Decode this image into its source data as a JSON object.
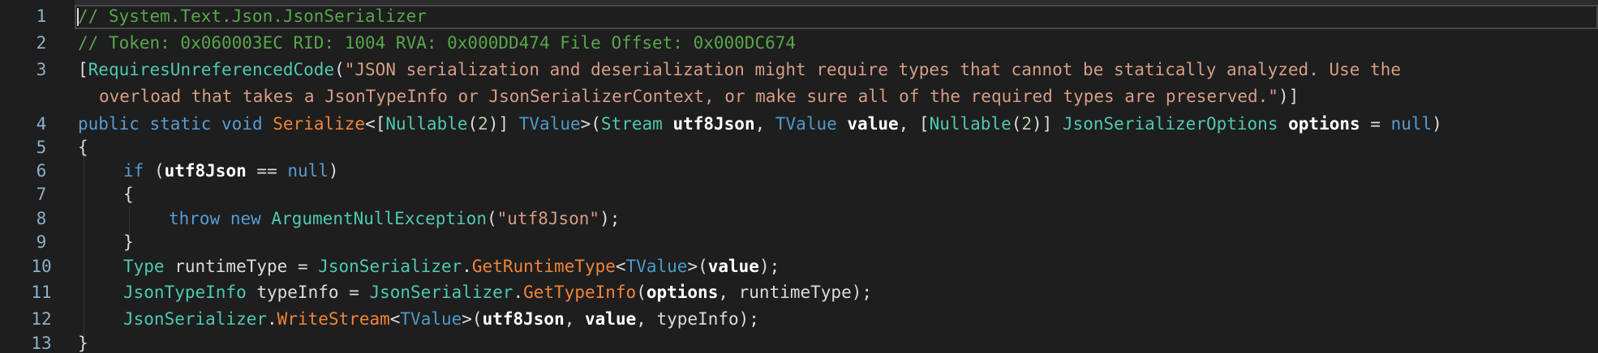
{
  "line_numbers": [
    "1",
    "2",
    "3",
    "4",
    "5",
    "6",
    "7",
    "8",
    "9",
    "10",
    "11",
    "12",
    "13"
  ],
  "lines": {
    "l1": {
      "comment": "// System.Text.Json.JsonSerializer"
    },
    "l2": {
      "comment": "// Token: 0x060003EC RID: 1004 RVA: 0x000DD474 File Offset: 0x000DC674"
    },
    "l3a": {
      "open": "[",
      "attr": "RequiresUnreferencedCode",
      "paren": "(",
      "str": "\"JSON serialization and deserialization might require types that cannot be statically analyzed. Use the"
    },
    "l3b": {
      "str": "overload that takes a JsonTypeInfo or JsonSerializerContext, or make sure all of the required types are preserved.\"",
      "close": ")]"
    },
    "l4": {
      "kw1": "public",
      "kw2": "static",
      "kw3": "void",
      "method": "Serialize",
      "lt": "<[",
      "nullable1": "Nullable",
      "p1": "(",
      "num1": "2",
      "p2": ")] ",
      "tvalue1": "TValue",
      "p3": ">(",
      "stream": "Stream",
      "arg1": "utf8Json",
      "comma1": ", ",
      "tvalue2": "TValue",
      "arg2": "value",
      "comma2": ", [",
      "nullable2": "Nullable",
      "p4": "(",
      "num2": "2",
      "p5": ")] ",
      "opts_type": "JsonSerializerOptions",
      "arg3": "options",
      "eq": " = ",
      "null": "null",
      "close": ")"
    },
    "l5": {
      "brace": "{"
    },
    "l6": {
      "kw": "if",
      "open": " (",
      "var": "utf8Json",
      "op": " == ",
      "null": "null",
      "close": ")"
    },
    "l7": {
      "brace": "{"
    },
    "l8": {
      "kw1": "throw",
      "kw2": "new",
      "type": "ArgumentNullException",
      "open": "(",
      "str": "\"utf8Json\"",
      "close": ");"
    },
    "l9": {
      "brace": "}"
    },
    "l10": {
      "type": "Type",
      "var": " runtimeType = ",
      "cls": "JsonSerializer",
      "dot": ".",
      "method": "GetRuntimeType",
      "lt": "<",
      "tvalue": "TValue",
      "gt": ">(",
      "arg": "value",
      "close": ");"
    },
    "l11": {
      "type": "JsonTypeInfo",
      "var": " typeInfo = ",
      "cls": "JsonSerializer",
      "dot": ".",
      "method": "GetTypeInfo",
      "open": "(",
      "arg": "options",
      "rest": ", runtimeType);"
    },
    "l12": {
      "cls": "JsonSerializer",
      "dot": ".",
      "method": "WriteStream",
      "lt": "<",
      "tvalue": "TValue",
      "gt": ">(",
      "arg1": "utf8Json",
      "comma": ", ",
      "arg2": "value",
      "rest": ", typeInfo);"
    },
    "l13": {
      "brace": "}"
    }
  },
  "colors": {
    "background": "#1e1e1e",
    "comment": "#57a64a",
    "keyword": "#569cd6",
    "type": "#4ec9b0",
    "method": "#ef8439",
    "string": "#d69d85",
    "line_number": "#8bb0c9"
  }
}
